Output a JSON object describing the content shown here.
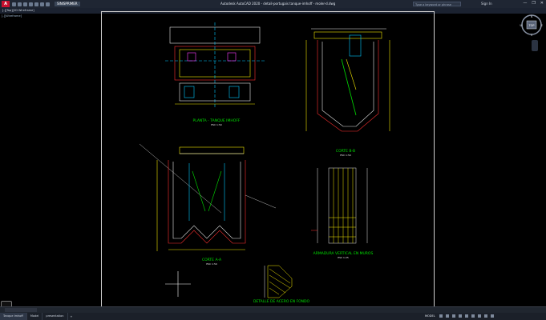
{
  "app": {
    "title": "Autodesk AutoCAD 2020 - detail-portugais tanque-imhoff - moler-d.dwg",
    "logo": "A",
    "workspace": "SINISPRIMER",
    "search_placeholder": "Type a keyword or phrase",
    "sign_in": "Sign In",
    "window_buttons": [
      "—",
      "❐",
      "✕"
    ]
  },
  "drawing_tab": "[-][Top][2D Wireframe]",
  "view_label": "[-][Wireframe]",
  "viewcube": {
    "top": "TOP",
    "n": "N",
    "s": "S",
    "e": "E",
    "w": "W"
  },
  "drawing": {
    "views": [
      {
        "title": "PLANTA - TANQUE IMHOFF",
        "scale": "ESC 1:50"
      },
      {
        "title": "CORTE B-B",
        "scale": "ESC 1:50"
      },
      {
        "title": "CORTE A-A",
        "scale": "ESC 1:50"
      },
      {
        "title": "ARMADURA VERTICAL EN MUROS",
        "scale": "ESC 1:25"
      },
      {
        "title": "DETALLE DE ACERO EN FONDO",
        "scale": "ESC 1:25"
      }
    ]
  },
  "status": {
    "tabs": [
      "Tanque Imhoff",
      "Model",
      "presentation"
    ],
    "active_tab": "Tanque Imhoff",
    "add_tab": "+",
    "space": "MODEL"
  },
  "colors": {
    "background": "#000000",
    "lines_white": "#e8e8e8",
    "lines_yellow": "#f2e600",
    "lines_red": "#ff3030",
    "lines_cyan": "#00c8ff",
    "lines_green": "#00e000",
    "lines_magenta": "#ff40ff"
  }
}
